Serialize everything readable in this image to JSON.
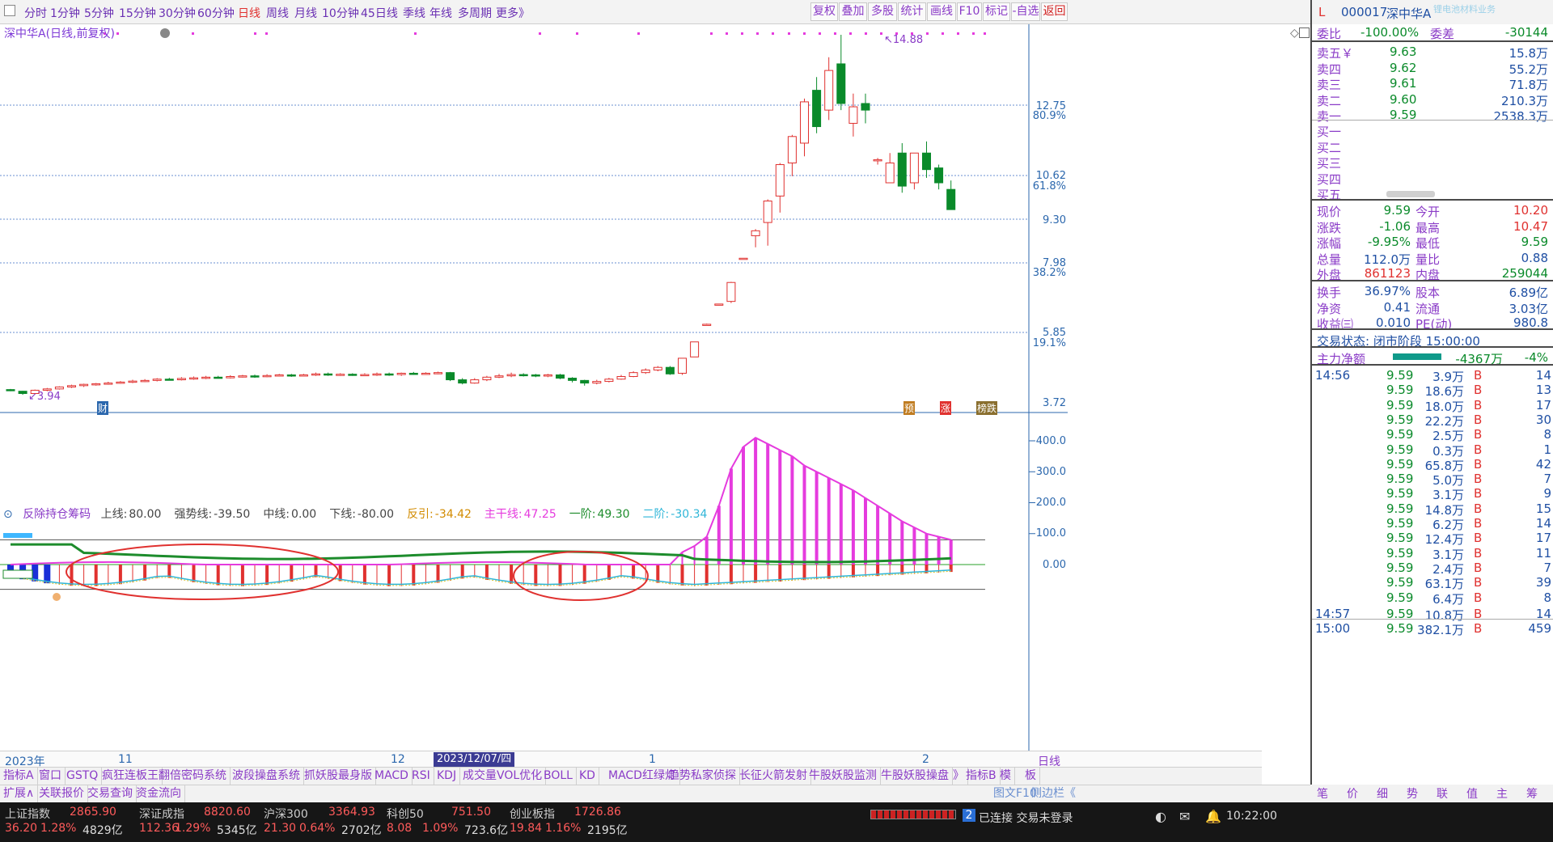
{
  "toolbar": {
    "periods": [
      "分时",
      "1分钟",
      "5分钟",
      "15分钟",
      "30分钟",
      "60分钟",
      "日线",
      "周线",
      "月线",
      "10分钟",
      "45日线",
      "季线",
      "年线",
      "多周期",
      "更多》"
    ],
    "active_period": "日线",
    "right_buttons": [
      "复权",
      "叠加",
      "多股",
      "统计",
      "画线",
      "F10",
      "标记",
      "-自选",
      "返回"
    ]
  },
  "chart": {
    "title": "深中华A(日线,前复权)",
    "price_ticks": [
      "12.75",
      "10.62",
      "9.30",
      "7.98",
      "5.85",
      "3.72"
    ],
    "pct_ticks": [
      "80.9%",
      "61.8%",
      "38.2%",
      "19.1%"
    ],
    "high_label": "14.88",
    "low_label": "3.94",
    "markers": [
      "财",
      "预",
      "涨",
      "榜跌"
    ],
    "candles": [
      {
        "o": 4.1,
        "c": 4.08,
        "h": 4.12,
        "l": 4.05
      },
      {
        "o": 4.05,
        "c": 3.98,
        "h": 4.06,
        "l": 3.94
      },
      {
        "o": 3.98,
        "c": 4.08,
        "h": 4.1,
        "l": 3.96
      },
      {
        "o": 4.08,
        "c": 4.12,
        "h": 4.15,
        "l": 4.05
      },
      {
        "o": 4.12,
        "c": 4.18,
        "h": 4.2,
        "l": 4.1
      },
      {
        "o": 4.18,
        "c": 4.22,
        "h": 4.25,
        "l": 4.15
      },
      {
        "o": 4.22,
        "c": 4.26,
        "h": 4.28,
        "l": 4.18
      },
      {
        "o": 4.26,
        "c": 4.28,
        "h": 4.3,
        "l": 4.22
      },
      {
        "o": 4.28,
        "c": 4.3,
        "h": 4.34,
        "l": 4.25
      },
      {
        "o": 4.3,
        "c": 4.33,
        "h": 4.36,
        "l": 4.28
      },
      {
        "o": 4.33,
        "c": 4.36,
        "h": 4.4,
        "l": 4.3
      },
      {
        "o": 4.36,
        "c": 4.38,
        "h": 4.42,
        "l": 4.33
      },
      {
        "o": 4.38,
        "c": 4.42,
        "h": 4.45,
        "l": 4.35
      },
      {
        "o": 4.42,
        "c": 4.4,
        "h": 4.46,
        "l": 4.38
      },
      {
        "o": 4.4,
        "c": 4.44,
        "h": 4.48,
        "l": 4.38
      },
      {
        "o": 4.44,
        "c": 4.46,
        "h": 4.5,
        "l": 4.4
      },
      {
        "o": 4.46,
        "c": 4.48,
        "h": 4.52,
        "l": 4.42
      },
      {
        "o": 4.48,
        "c": 4.46,
        "h": 4.52,
        "l": 4.44
      },
      {
        "o": 4.46,
        "c": 4.5,
        "h": 4.54,
        "l": 4.44
      },
      {
        "o": 4.5,
        "c": 4.52,
        "h": 4.55,
        "l": 4.47
      },
      {
        "o": 4.52,
        "c": 4.5,
        "h": 4.56,
        "l": 4.46
      },
      {
        "o": 4.5,
        "c": 4.53,
        "h": 4.57,
        "l": 4.48
      },
      {
        "o": 4.53,
        "c": 4.55,
        "h": 4.58,
        "l": 4.5
      },
      {
        "o": 4.55,
        "c": 4.52,
        "h": 4.58,
        "l": 4.49
      },
      {
        "o": 4.52,
        "c": 4.55,
        "h": 4.58,
        "l": 4.5
      },
      {
        "o": 4.55,
        "c": 4.58,
        "h": 4.62,
        "l": 4.52
      },
      {
        "o": 4.58,
        "c": 4.55,
        "h": 4.62,
        "l": 4.52
      },
      {
        "o": 4.55,
        "c": 4.57,
        "h": 4.6,
        "l": 4.52
      },
      {
        "o": 4.57,
        "c": 4.55,
        "h": 4.6,
        "l": 4.52
      },
      {
        "o": 4.55,
        "c": 4.56,
        "h": 4.6,
        "l": 4.52
      },
      {
        "o": 4.56,
        "c": 4.58,
        "h": 4.62,
        "l": 4.52
      },
      {
        "o": 4.58,
        "c": 4.56,
        "h": 4.62,
        "l": 4.52
      },
      {
        "o": 4.56,
        "c": 4.6,
        "h": 4.62,
        "l": 4.52
      },
      {
        "o": 4.6,
        "c": 4.58,
        "h": 4.64,
        "l": 4.55
      },
      {
        "o": 4.58,
        "c": 4.6,
        "h": 4.63,
        "l": 4.55
      },
      {
        "o": 4.6,
        "c": 4.62,
        "h": 4.65,
        "l": 4.57
      },
      {
        "o": 4.62,
        "c": 4.4,
        "h": 4.64,
        "l": 4.36
      },
      {
        "o": 4.4,
        "c": 4.3,
        "h": 4.45,
        "l": 4.26
      },
      {
        "o": 4.3,
        "c": 4.4,
        "h": 4.45,
        "l": 4.28
      },
      {
        "o": 4.4,
        "c": 4.48,
        "h": 4.52,
        "l": 4.36
      },
      {
        "o": 4.48,
        "c": 4.52,
        "h": 4.58,
        "l": 4.45
      },
      {
        "o": 4.52,
        "c": 4.56,
        "h": 4.62,
        "l": 4.48
      },
      {
        "o": 4.56,
        "c": 4.55,
        "h": 4.6,
        "l": 4.5
      },
      {
        "o": 4.55,
        "c": 4.52,
        "h": 4.58,
        "l": 4.48
      },
      {
        "o": 4.52,
        "c": 4.55,
        "h": 4.58,
        "l": 4.48
      },
      {
        "o": 4.55,
        "c": 4.45,
        "h": 4.58,
        "l": 4.42
      },
      {
        "o": 4.45,
        "c": 4.38,
        "h": 4.48,
        "l": 4.32
      },
      {
        "o": 4.38,
        "c": 4.3,
        "h": 4.4,
        "l": 4.22
      },
      {
        "o": 4.3,
        "c": 4.35,
        "h": 4.4,
        "l": 4.26
      },
      {
        "o": 4.35,
        "c": 4.42,
        "h": 4.46,
        "l": 4.32
      },
      {
        "o": 4.42,
        "c": 4.5,
        "h": 4.55,
        "l": 4.4
      },
      {
        "o": 4.5,
        "c": 4.62,
        "h": 4.66,
        "l": 4.48
      },
      {
        "o": 4.62,
        "c": 4.7,
        "h": 4.75,
        "l": 4.58
      },
      {
        "o": 4.7,
        "c": 4.78,
        "h": 4.82,
        "l": 4.66
      },
      {
        "o": 4.78,
        "c": 4.58,
        "h": 4.82,
        "l": 4.55
      },
      {
        "o": 4.6,
        "c": 5.06,
        "h": 5.06,
        "l": 4.55
      },
      {
        "o": 5.1,
        "c": 5.56,
        "h": 5.56,
        "l": 5.1
      },
      {
        "o": 6.08,
        "c": 6.1,
        "h": 6.12,
        "l": 6.08
      },
      {
        "o": 6.7,
        "c": 6.72,
        "h": 6.72,
        "l": 6.68
      },
      {
        "o": 6.8,
        "c": 7.38,
        "h": 7.4,
        "l": 6.75
      },
      {
        "o": 8.1,
        "c": 8.12,
        "h": 8.12,
        "l": 8.1
      },
      {
        "o": 8.8,
        "c": 8.95,
        "h": 9.0,
        "l": 8.45
      },
      {
        "o": 9.2,
        "c": 9.85,
        "h": 9.9,
        "l": 8.5
      },
      {
        "o": 10.0,
        "c": 10.95,
        "h": 11.0,
        "l": 9.5
      },
      {
        "o": 11.0,
        "c": 11.8,
        "h": 11.85,
        "l": 10.6
      },
      {
        "o": 11.6,
        "c": 12.85,
        "h": 12.95,
        "l": 11.2
      },
      {
        "o": 13.2,
        "c": 12.1,
        "h": 13.6,
        "l": 11.9
      },
      {
        "o": 12.6,
        "c": 13.8,
        "h": 14.2,
        "l": 12.3
      },
      {
        "o": 14.0,
        "c": 12.8,
        "h": 14.88,
        "l": 12.6
      },
      {
        "o": 12.2,
        "c": 12.7,
        "h": 13.1,
        "l": 11.8
      },
      {
        "o": 12.8,
        "c": 12.6,
        "h": 13.1,
        "l": 12.2
      },
      {
        "o": 11.1,
        "c": 11.1,
        "h": 11.15,
        "l": 10.95
      },
      {
        "o": 10.4,
        "c": 11.0,
        "h": 11.3,
        "l": 10.4
      },
      {
        "o": 11.3,
        "c": 10.3,
        "h": 11.6,
        "l": 10.1
      },
      {
        "o": 10.4,
        "c": 11.3,
        "h": 11.3,
        "l": 10.2
      },
      {
        "o": 11.3,
        "c": 10.8,
        "h": 11.65,
        "l": 10.55
      },
      {
        "o": 10.85,
        "c": 10.4,
        "h": 10.95,
        "l": 10.2
      },
      {
        "o": 10.2,
        "c": 9.59,
        "h": 10.47,
        "l": 9.59
      }
    ]
  },
  "indicator": {
    "name": "反除持仓筹码",
    "params": [
      {
        "label": "上线:",
        "value": "80.00"
      },
      {
        "label": "强势线:",
        "value": "-39.50"
      },
      {
        "label": "中线:",
        "value": "0.00"
      },
      {
        "label": "下线:",
        "value": "-80.00"
      },
      {
        "label": "反引:",
        "value": "-34.42"
      },
      {
        "label": "主干线:",
        "value": "47.25"
      },
      {
        "label": "一阶:",
        "value": "49.30"
      },
      {
        "label": "二阶:",
        "value": "-30.34"
      }
    ],
    "yticks": [
      "400.0",
      "300.0",
      "200.0",
      "100.0",
      "0.00"
    ]
  },
  "xaxis": {
    "labels": [
      "2023年",
      "11",
      "12",
      "1",
      "2"
    ],
    "selected_date": "2023/12/07/四",
    "period": "日线"
  },
  "tabs_row1": [
    "指标A",
    "窗口",
    "GSTQ",
    "疯狂连板王",
    "翻倍密码系统",
    "波段操盘系统",
    "抓妖股最身版",
    "MACD",
    "RSI",
    "KDJ",
    "成交量VOL优化",
    "BOLL",
    "KD",
    "MACD红绿灯",
    "趋势私家侦探",
    "长征火箭发射",
    "牛股妖股监测",
    "牛股妖股操盘",
    "》",
    "指标B",
    "模",
    "板"
  ],
  "tabs_row2": [
    "扩展∧",
    "关联报价",
    "交易查询",
    "资金流向"
  ],
  "tabs_row2_right": [
    "图文F10",
    "侧边栏《"
  ],
  "side_tabs": [
    "笔",
    "价",
    "细",
    "势",
    "联",
    "值",
    "主",
    "筹"
  ],
  "status": {
    "indices": [
      {
        "name": "上证指数",
        "value": "2865.90",
        "chg": "36.20",
        "pct": "1.28%",
        "amt": "4829亿"
      },
      {
        "name": "深证成指",
        "value": "8820.60",
        "chg": "112.36",
        "pct": "1.29%",
        "amt": "5345亿"
      },
      {
        "name": "沪深300",
        "value": "3364.93",
        "chg": "21.30",
        "pct": "0.64%",
        "amt": "2702亿"
      },
      {
        "name": "科创50",
        "value": "751.50",
        "chg": "8.08",
        "pct": "1.09%",
        "amt": "723.6亿"
      },
      {
        "name": "创业板指",
        "value": "1726.86",
        "chg": "19.84",
        "pct": "1.16%",
        "amt": "2195亿"
      }
    ],
    "conn_badge": "2",
    "conn_text": "已连接 交易未登录",
    "time": "10:22:00"
  },
  "quote": {
    "flag": "L",
    "code": "000017",
    "name": "深中华A",
    "sector": "锂电池材料业务",
    "weibi_label": "委比",
    "weibi": "-100.00%",
    "weicha_label": "委差",
    "weicha": "-30144",
    "sells": [
      {
        "label": "卖五￥",
        "price": "9.63",
        "vol": "15.8万"
      },
      {
        "label": "卖四",
        "price": "9.62",
        "vol": "55.2万"
      },
      {
        "label": "卖三",
        "price": "9.61",
        "vol": "71.8万"
      },
      {
        "label": "卖二",
        "price": "9.60",
        "vol": "210.3万"
      },
      {
        "label": "卖一",
        "price": "9.59",
        "vol": "2538.3万"
      }
    ],
    "buys": [
      "买一",
      "买二",
      "买三",
      "买四",
      "买五"
    ],
    "stats": [
      {
        "l1": "现价",
        "v1": "9.59",
        "l2": "今开",
        "v2": "10.20"
      },
      {
        "l1": "涨跌",
        "v1": "-1.06",
        "l2": "最高",
        "v2": "10.47"
      },
      {
        "l1": "涨幅",
        "v1": "-9.95%",
        "l2": "最低",
        "v2": "9.59"
      },
      {
        "l1": "总量",
        "v1": "112.0万",
        "l2": "量比",
        "v2": "0.88"
      },
      {
        "l1": "外盘",
        "v1": "861123",
        "l2": "内盘",
        "v2": "259044"
      }
    ],
    "stats2": [
      {
        "l1": "换手",
        "v1": "36.97%",
        "l2": "股本",
        "v2": "6.89亿"
      },
      {
        "l1": "净资",
        "v1": "0.41",
        "l2": "流通",
        "v2": "3.03亿"
      },
      {
        "l1": "收益㈢",
        "v1": "0.010",
        "l2": "PE(动)",
        "v2": "980.8"
      }
    ],
    "trade_status": "交易状态: 闭市阶段 15:00:00",
    "main_flow_label": "主力净额",
    "main_flow": "-4367万",
    "main_flow_pct": "-4%",
    "ticks": [
      {
        "t": "14:56",
        "p": "9.59",
        "v": "3.9万",
        "bs": "B",
        "n": "14"
      },
      {
        "t": "",
        "p": "9.59",
        "v": "18.6万",
        "bs": "B",
        "n": "13"
      },
      {
        "t": "",
        "p": "9.59",
        "v": "18.0万",
        "bs": "B",
        "n": "17"
      },
      {
        "t": "",
        "p": "9.59",
        "v": "22.2万",
        "bs": "B",
        "n": "30"
      },
      {
        "t": "",
        "p": "9.59",
        "v": "2.5万",
        "bs": "B",
        "n": "8"
      },
      {
        "t": "",
        "p": "9.59",
        "v": "0.3万",
        "bs": "B",
        "n": "1"
      },
      {
        "t": "",
        "p": "9.59",
        "v": "65.8万",
        "bs": "B",
        "n": "42"
      },
      {
        "t": "",
        "p": "9.59",
        "v": "5.0万",
        "bs": "B",
        "n": "7"
      },
      {
        "t": "",
        "p": "9.59",
        "v": "3.1万",
        "bs": "B",
        "n": "9"
      },
      {
        "t": "",
        "p": "9.59",
        "v": "14.8万",
        "bs": "B",
        "n": "15"
      },
      {
        "t": "",
        "p": "9.59",
        "v": "6.2万",
        "bs": "B",
        "n": "14"
      },
      {
        "t": "",
        "p": "9.59",
        "v": "12.4万",
        "bs": "B",
        "n": "17"
      },
      {
        "t": "",
        "p": "9.59",
        "v": "3.1万",
        "bs": "B",
        "n": "11"
      },
      {
        "t": "",
        "p": "9.59",
        "v": "2.4万",
        "bs": "B",
        "n": "7"
      },
      {
        "t": "",
        "p": "9.59",
        "v": "63.1万",
        "bs": "B",
        "n": "39"
      },
      {
        "t": "",
        "p": "9.59",
        "v": "6.4万",
        "bs": "B",
        "n": "8"
      },
      {
        "t": "14:57",
        "p": "9.59",
        "v": "10.8万",
        "bs": "B",
        "n": "14"
      },
      {
        "t": "15:00",
        "p": "9.59",
        "v": "382.1万",
        "bs": "B",
        "n": "459"
      }
    ]
  }
}
